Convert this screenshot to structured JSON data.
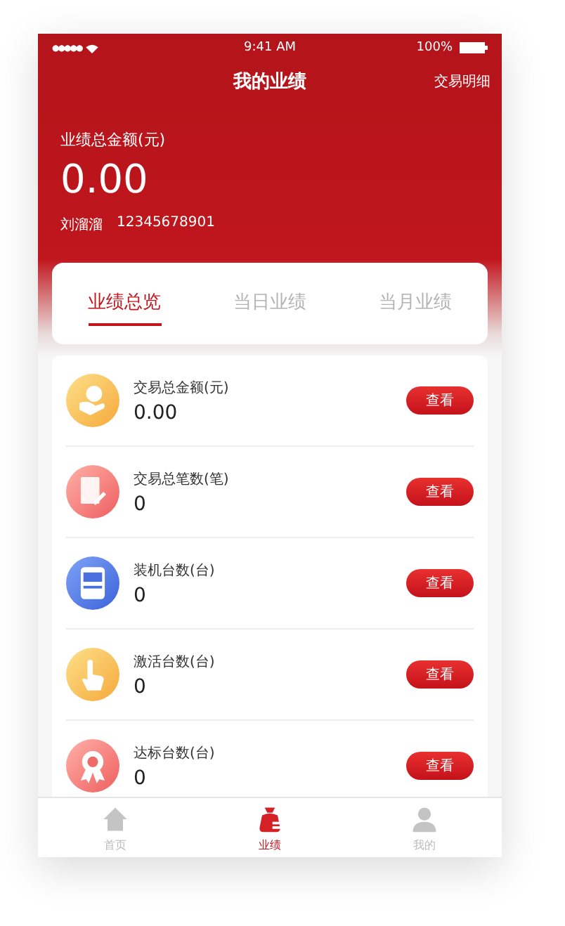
{
  "status_bar": {
    "signal": "●●●●●",
    "time": "9:41 AM",
    "battery": "100%"
  },
  "nav": {
    "title": "我的业绩",
    "action": "交易明细"
  },
  "summary": {
    "label": "业绩总金额(元)",
    "amount": "0.00",
    "name": "刘溜溜",
    "phone": "12345678901"
  },
  "tabs": [
    {
      "label": "业绩总览",
      "selected": true
    },
    {
      "label": "当日业绩",
      "selected": false
    },
    {
      "label": "当月业绩",
      "selected": false
    }
  ],
  "items": [
    {
      "kind": "coins",
      "label": "交易总金额(元)",
      "value": "0.00",
      "button": "查看"
    },
    {
      "kind": "receipt",
      "label": "交易总笔数(笔)",
      "value": "0",
      "button": "查看"
    },
    {
      "kind": "pos",
      "label": "装机台数(台)",
      "value": "0",
      "button": "查看"
    },
    {
      "kind": "hand",
      "label": "激活台数(台)",
      "value": "0",
      "button": "查看"
    },
    {
      "kind": "award",
      "label": "达标台数(台)",
      "value": "0",
      "button": "查看"
    }
  ],
  "bottom_tabs": [
    {
      "kind": "home",
      "label": "首页",
      "selected": false
    },
    {
      "kind": "bag",
      "label": "业绩",
      "selected": true
    },
    {
      "kind": "person",
      "label": "我的",
      "selected": false
    }
  ]
}
